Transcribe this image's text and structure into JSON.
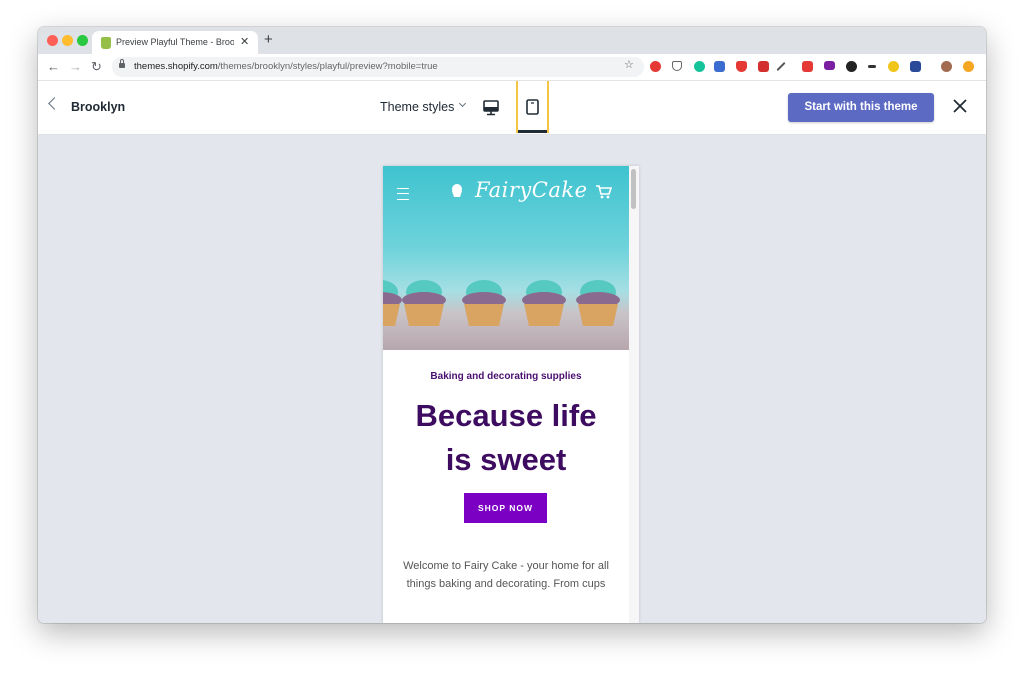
{
  "browser": {
    "tab_title": "Preview Playful Theme - Brooklyn",
    "tab_close": "✕",
    "new_tab": "+",
    "url_host": "themes.shopify.com",
    "url_path": "/themes/brooklyn/styles/playful/preview?mobile=true",
    "nav": {
      "back": "←",
      "forward": "→",
      "reload": "↻"
    },
    "star": "☆"
  },
  "app": {
    "back_label": "Brooklyn",
    "styles_label": "Theme styles",
    "start_button": "Start with this theme",
    "active_view": "mobile",
    "accent_color": "#5c6ac4",
    "highlight_color": "#f4c542"
  },
  "preview": {
    "logo": "FairyCake",
    "subheading": "Baking and decorating supplies",
    "headline_line1": "Because life",
    "headline_line2": "is sweet",
    "cta": "SHOP NOW",
    "body_line1": "Welcome to Fairy Cake - your home for all",
    "body_line2": "things baking and decorating. From cups",
    "headline_color": "#3d0b60",
    "cta_color": "#7c00c4"
  }
}
